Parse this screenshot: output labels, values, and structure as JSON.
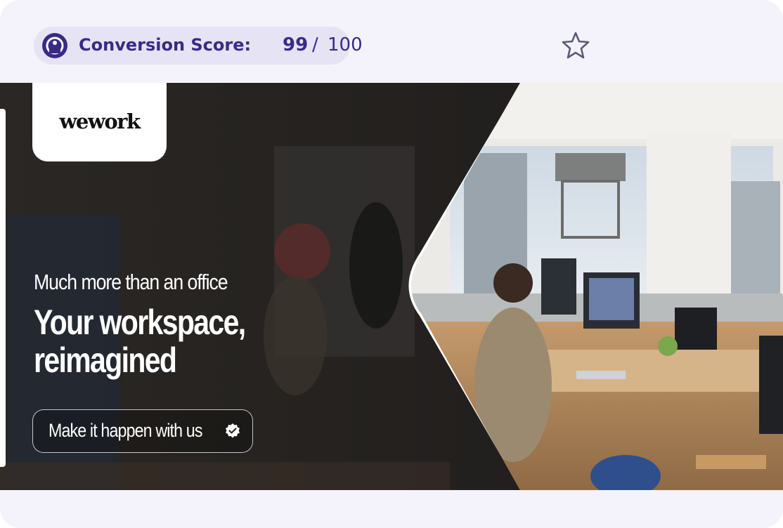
{
  "header": {
    "score_label": "Conversion Score:",
    "score_value": "99",
    "score_separator": "/",
    "score_max": "100",
    "score_icon": "gauge-icon",
    "favorite_icon": "star-outline-icon"
  },
  "ad": {
    "brand": "wework",
    "tagline": "Much more than an office",
    "headline": "Your workspace, reimagined",
    "cta_label": "Make it happen with us",
    "cta_icon": "verified-check-icon"
  },
  "colors": {
    "accent": "#3a2a86",
    "pill_background": "#e6e3f5",
    "card_background": "#f4f3fb",
    "banner_dark": "#1d1c1e"
  }
}
